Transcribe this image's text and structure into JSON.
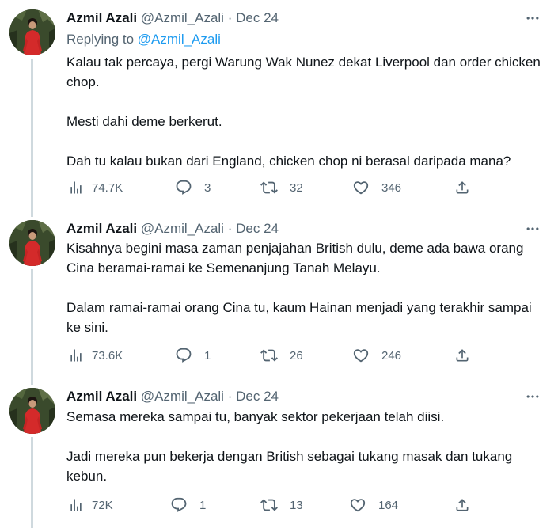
{
  "tweets": [
    {
      "name": "Azmil Azali",
      "handle": "@Azmil_Azali",
      "dot": "·",
      "date": "Dec 24",
      "replying_prefix": "Replying to ",
      "replying_handle": "@Azmil_Azali",
      "paragraphs": [
        "Kalau tak percaya, pergi Warung Wak Nunez dekat Liverpool dan order chicken chop.",
        "Mesti dahi deme berkerut.",
        "Dah tu kalau bukan dari England, chicken chop ni berasal daripada mana?"
      ],
      "views": "74.7K",
      "replies": "3",
      "retweets": "32",
      "likes": "346"
    },
    {
      "name": "Azmil Azali",
      "handle": "@Azmil_Azali",
      "dot": "·",
      "date": "Dec 24",
      "paragraphs": [
        "Kisahnya begini masa zaman penjajahan British dulu, deme ada bawa orang Cina beramai-ramai ke Semenanjung Tanah Melayu.",
        "Dalam ramai-ramai orang Cina tu, kaum Hainan menjadi yang terakhir sampai ke sini."
      ],
      "views": "73.6K",
      "replies": "1",
      "retweets": "26",
      "likes": "246"
    },
    {
      "name": "Azmil Azali",
      "handle": "@Azmil_Azali",
      "dot": "·",
      "date": "Dec 24",
      "paragraphs": [
        "Semasa mereka sampai tu, banyak sektor pekerjaan telah diisi.",
        "Jadi mereka pun bekerja dengan British sebagai tukang masak dan tukang kebun."
      ],
      "views": "72K",
      "replies": "1",
      "retweets": "13",
      "likes": "164"
    }
  ],
  "icons": {
    "views": "analytics-icon",
    "reply": "reply-icon",
    "retweet": "retweet-icon",
    "like": "heart-icon",
    "share": "share-icon",
    "more": "more-options-icon"
  },
  "colors": {
    "text": "#0f1419",
    "secondary": "#536471",
    "link": "#1d9bf0",
    "thread_line": "#cfd9de",
    "divider": "#eff3f4"
  }
}
